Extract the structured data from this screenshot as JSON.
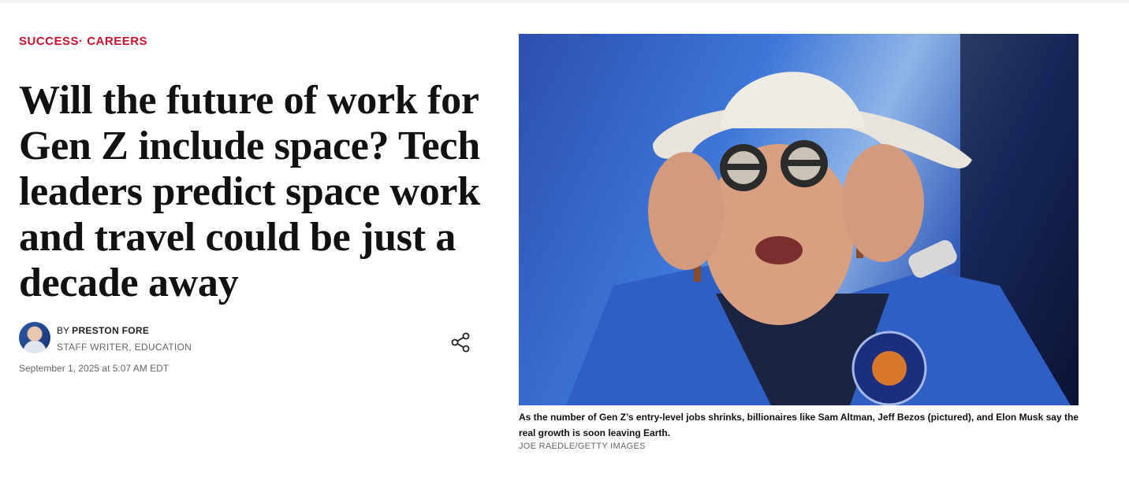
{
  "breadcrumb": {
    "section": "SUCCESS",
    "separator": "· ",
    "subsection": "CAREERS"
  },
  "article": {
    "headline": "Will the future of work for Gen Z include space? Tech leaders predict space work and travel could be just a decade away",
    "author_prefix": "BY",
    "author_name": "PRESTON FORE",
    "author_role": "STAFF WRITER, EDUCATION",
    "date": "September 1, 2025 at 5:07 AM EDT"
  },
  "image": {
    "caption": "As the number of Gen Z’s entry-level jobs shrinks, billionaires like Sam Altman, Jeff Bezos (pictured), and Elon Musk say the real growth is soon leaving Earth.",
    "credit": "JOE RAEDLE/GETTY IMAGES"
  },
  "colors": {
    "accent": "#c8102e",
    "text": "#111111",
    "muted": "#666666"
  },
  "icons": {
    "share": "share-icon",
    "avatar": "author-avatar"
  }
}
